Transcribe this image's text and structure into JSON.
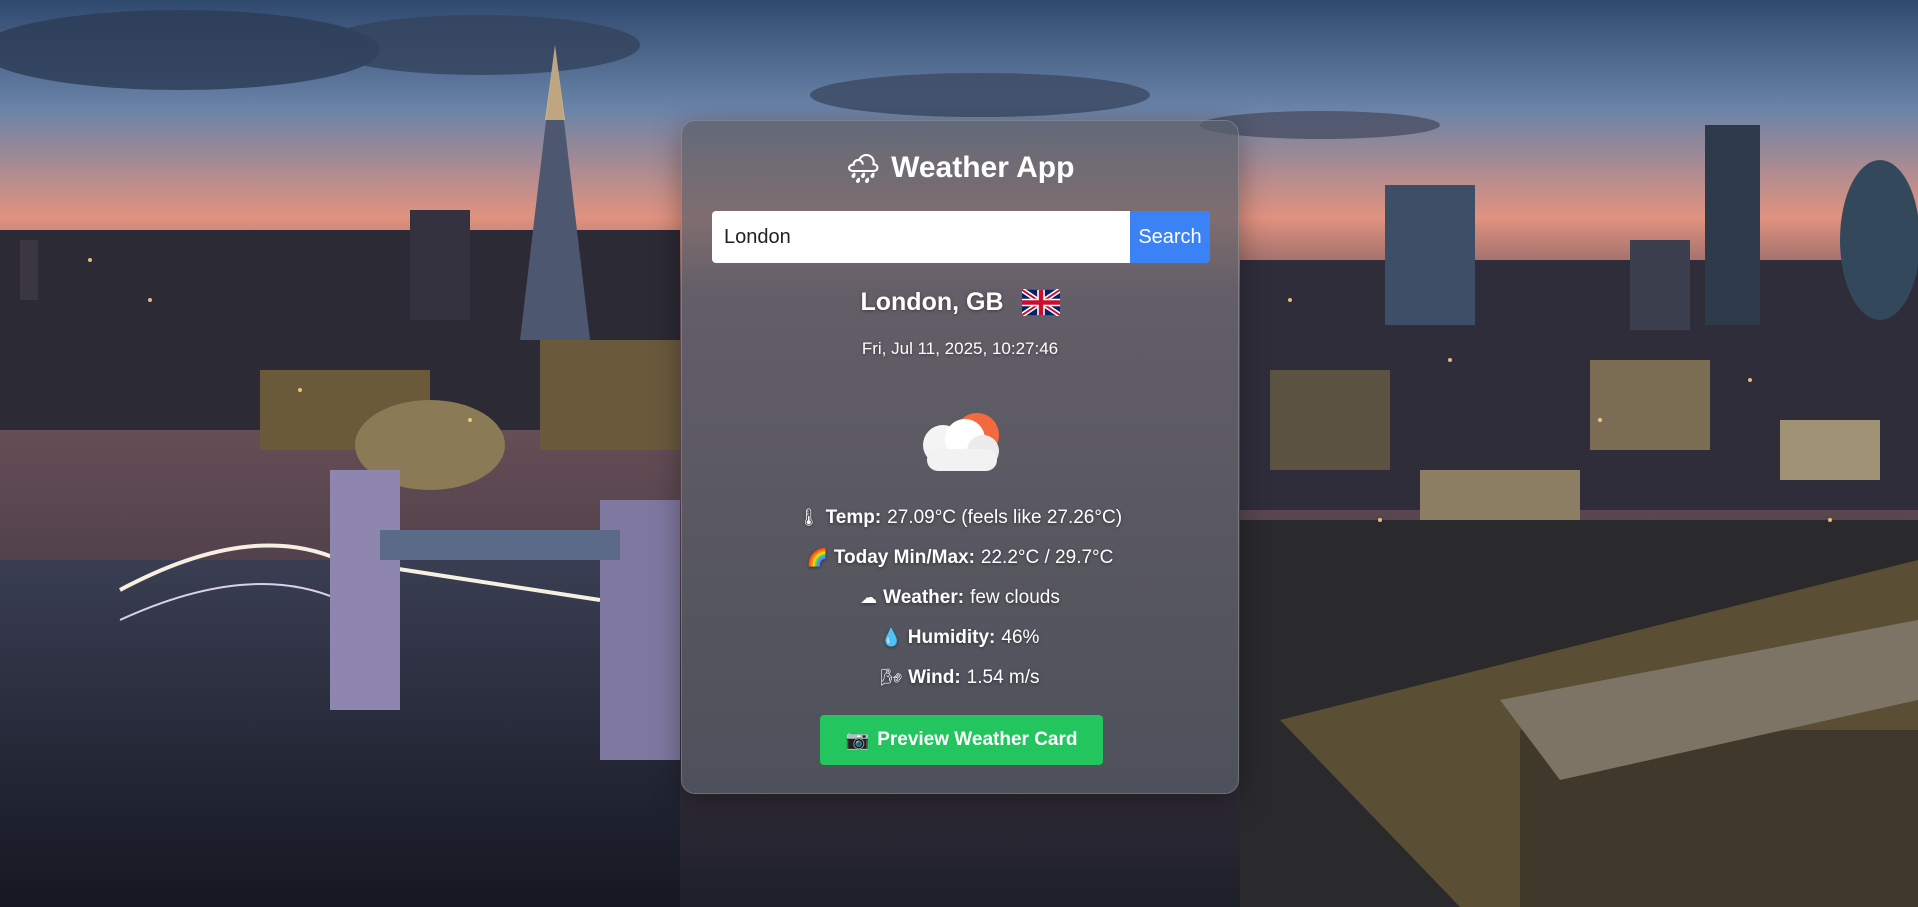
{
  "app": {
    "title": "Weather App",
    "title_icon": "cloud-rain-icon"
  },
  "search": {
    "value": "London",
    "button_label": "Search"
  },
  "location": {
    "city": "London, GB",
    "flag": "gb-flag-icon",
    "datetime": "Fri, Jul 11, 2025, 10:27:46"
  },
  "current": {
    "icon": "few-clouds-icon",
    "temp_label": "Temp:",
    "temp_value": "27.09°C (feels like 27.26°C)",
    "minmax_label": "Today Min/Max:",
    "minmax_value": "22.2°C / 29.7°C",
    "weather_label": "Weather:",
    "weather_value": "few clouds",
    "humidity_label": "Humidity:",
    "humidity_value": "46%",
    "wind_label": "Wind:",
    "wind_value": "1.54 m/s"
  },
  "preview_button_label": "Preview Weather Card",
  "colors": {
    "search_button": "#3b82f6",
    "preview_button": "#22c55e",
    "text": "#ffffff"
  }
}
